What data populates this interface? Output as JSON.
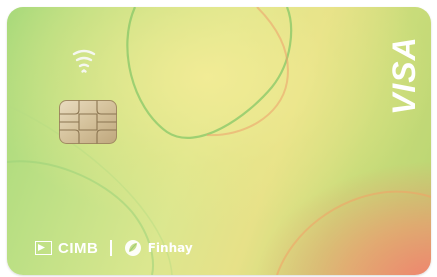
{
  "card": {
    "network": "VISA",
    "issuer": "CIMB",
    "partner": "Finhay",
    "icons": {
      "contactless": "contactless-icon",
      "chip": "emv-chip-icon",
      "issuer_logo": "cimb-logo-icon",
      "partner_logo": "finhay-logo-icon"
    },
    "colors": {
      "green": "#a6d97a",
      "yellow": "#e7e188",
      "coral": "#f67a6e",
      "logo_text": "#ffffff"
    }
  }
}
